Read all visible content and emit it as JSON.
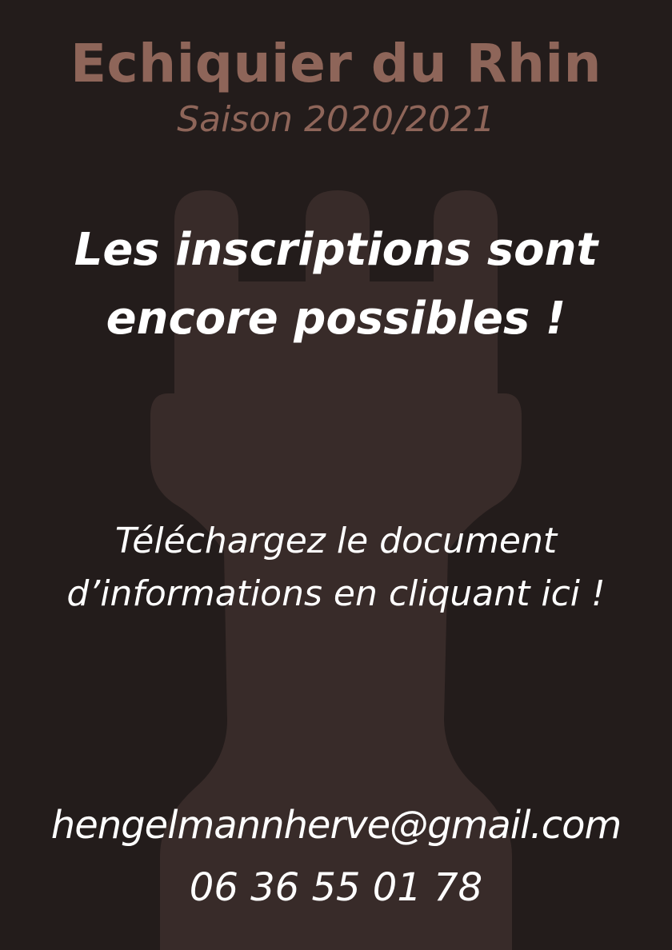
{
  "theme": {
    "background": "#231c1b",
    "accent": "#8e6559",
    "watermark": "#382b29",
    "text": "#ffffff"
  },
  "header": {
    "club_name": "Echiquier du Rhin",
    "season": "Saison 2020/2021"
  },
  "watermark": {
    "icon": "chess-rook-icon"
  },
  "headline": {
    "line1": "Les inscriptions sont",
    "line2": "encore possibles !"
  },
  "call_to_action": {
    "line1": "Téléchargez le document",
    "line2": "d’informations en cliquant ici !"
  },
  "contact": {
    "email": "hengelmannherve@gmail.com",
    "phone": "06 36 55 01 78"
  }
}
